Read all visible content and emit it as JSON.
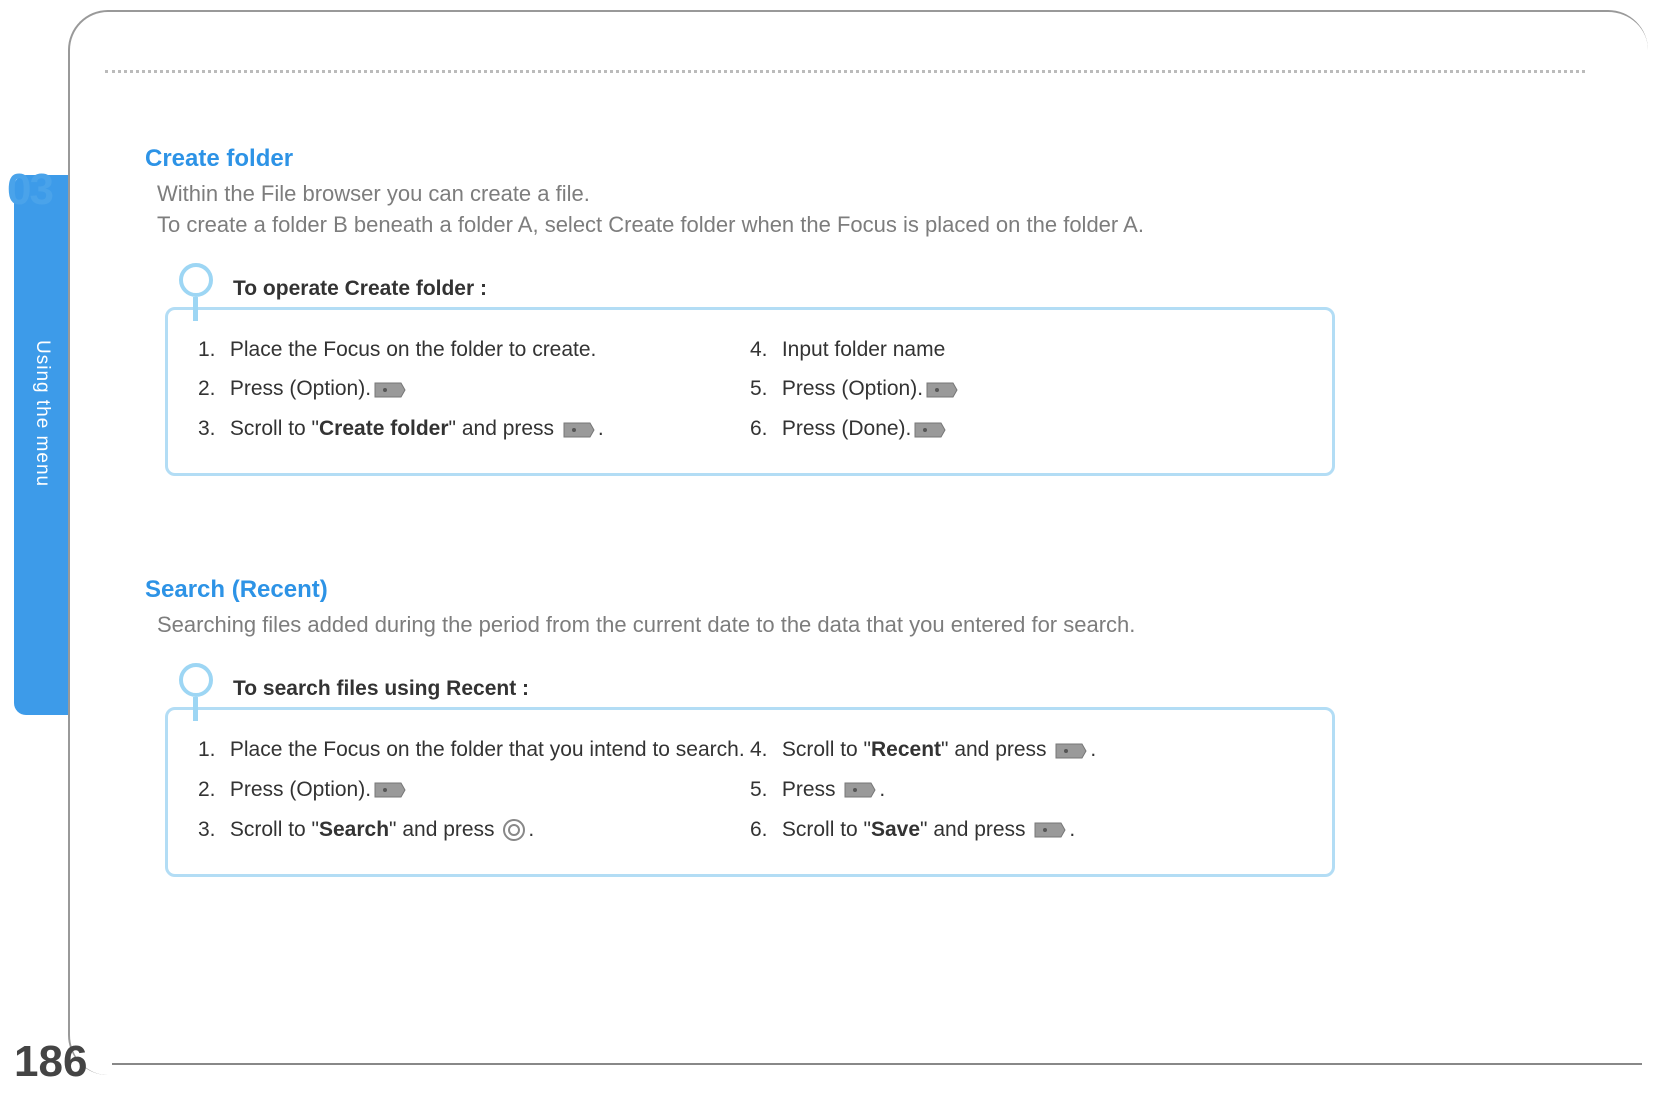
{
  "chapter": {
    "number": "03",
    "label": "Using the menu"
  },
  "page_number": "186",
  "section1": {
    "title": "Create folder",
    "desc_line1": "Within the File browser you can create a file.",
    "desc_line2": "To create a folder B beneath a folder A, select Create folder when the Focus is placed on the folder A.",
    "callout_heading": "To operate Create folder :",
    "steps_left": [
      {
        "n": "1.",
        "pre": "Place the Focus on the folder to create.",
        "bold": "",
        "post": "",
        "icon": ""
      },
      {
        "n": "2.",
        "pre": "Press ",
        "bold": "",
        "post": " (Option).",
        "icon": "softkey"
      },
      {
        "n": "3.",
        "pre": "Scroll to \"",
        "bold": "Create folder",
        "post": "\" and press ",
        "icon": "softkey",
        "tail": "."
      }
    ],
    "steps_right": [
      {
        "n": "4.",
        "pre": "Input folder name",
        "bold": "",
        "post": "",
        "icon": ""
      },
      {
        "n": "5.",
        "pre": "Press ",
        "bold": "",
        "post": " (Option).",
        "icon": "softkey"
      },
      {
        "n": "6.",
        "pre": "Press ",
        "bold": "",
        "post": " (Done).",
        "icon": "softkey"
      }
    ]
  },
  "section2": {
    "title": "Search (Recent)",
    "desc_line1": "Searching files added during the period from the current date to the data that you entered for search.",
    "callout_heading": "To search files using Recent :",
    "steps_left": [
      {
        "n": "1.",
        "pre": "Place the Focus on the folder that you intend to search.",
        "bold": "",
        "post": "",
        "icon": ""
      },
      {
        "n": "2.",
        "pre": "Press ",
        "bold": "",
        "post": " (Option).",
        "icon": "softkey"
      },
      {
        "n": "3.",
        "pre": "Scroll to \"",
        "bold": "Search",
        "post": "\" and press ",
        "icon": "ok",
        "tail": "."
      }
    ],
    "steps_right": [
      {
        "n": "4.",
        "pre": "Scroll to \"",
        "bold": "Recent",
        "post": "\" and press ",
        "icon": "softkey",
        "tail": "."
      },
      {
        "n": "5.",
        "pre": "Press ",
        "bold": "",
        "post": "",
        "icon": "softkey",
        "tail": "."
      },
      {
        "n": "6.",
        "pre": "Scroll to \"",
        "bold": "Save",
        "post": "\" and press ",
        "icon": "softkey",
        "tail": "."
      }
    ]
  }
}
